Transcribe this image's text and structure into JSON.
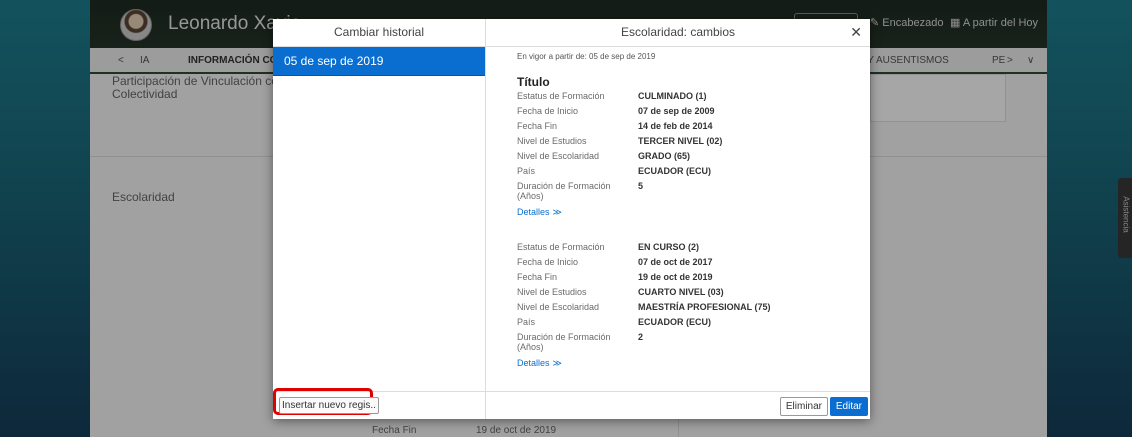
{
  "background": {
    "user_name": "Leonardo Xavie",
    "header_encabezado": "Encabezado",
    "header_a_partir": "A partir del Hoy",
    "tabs": {
      "prev": "<",
      "partial_left": "IA",
      "active": "INFORMACIÓN CON",
      "partial_right": "S Y AUSENTISMOS",
      "pe": "PE",
      "next": ">",
      "menu": "∨"
    },
    "section_participacion": "Participación de Vinculación co",
    "section_colectividad": "Colectividad",
    "section_escolaridad": "Escolaridad",
    "bottom_fecha_fin_label": "Fecha Fin",
    "bottom_fecha_fin_value": "19 de oct de 2019",
    "side_tab": "Asistencia"
  },
  "dialog": {
    "left_header": "Cambiar historial",
    "history_items": [
      "05 de sep de 2019"
    ],
    "insert_button": "Insertar nuevo regis..",
    "right_header": "Escolaridad: cambios",
    "close": "✕",
    "effective": "En vigor a partir de: 05 de sep de 2019",
    "section_title": "Título",
    "record1": [
      {
        "label": "Estatus de Formación",
        "value": "CULMINADO (1)"
      },
      {
        "label": "Fecha de Inicio",
        "value": "07 de sep de 2009"
      },
      {
        "label": "Fecha Fin",
        "value": "14 de feb de 2014"
      },
      {
        "label": "Nivel de Estudios",
        "value": "TERCER NIVEL (02)"
      },
      {
        "label": "Nivel de Escolaridad",
        "value": "GRADO (65)"
      },
      {
        "label": "País",
        "value": "ECUADOR (ECU)"
      },
      {
        "label": "Duración de Formación (Años)",
        "value": "5"
      }
    ],
    "record2": [
      {
        "label": "Estatus de Formación",
        "value": "EN CURSO (2)"
      },
      {
        "label": "Fecha de Inicio",
        "value": "07 de oct de 2017"
      },
      {
        "label": "Fecha Fin",
        "value": "19 de oct de 2019"
      },
      {
        "label": "Nivel de Estudios",
        "value": "CUARTO NIVEL (03)"
      },
      {
        "label": "Nivel de Escolaridad",
        "value": "MAESTRÍA PROFESIONAL (75)"
      },
      {
        "label": "País",
        "value": "ECUADOR (ECU)"
      },
      {
        "label": "Duración de Formación (Años)",
        "value": "2"
      }
    ],
    "details_link": "Detalles",
    "delete_button": "Eliminar",
    "edit_button": "Editar"
  },
  "colors": {
    "accent": "#0a6ed1",
    "highlight": "#e00000"
  }
}
